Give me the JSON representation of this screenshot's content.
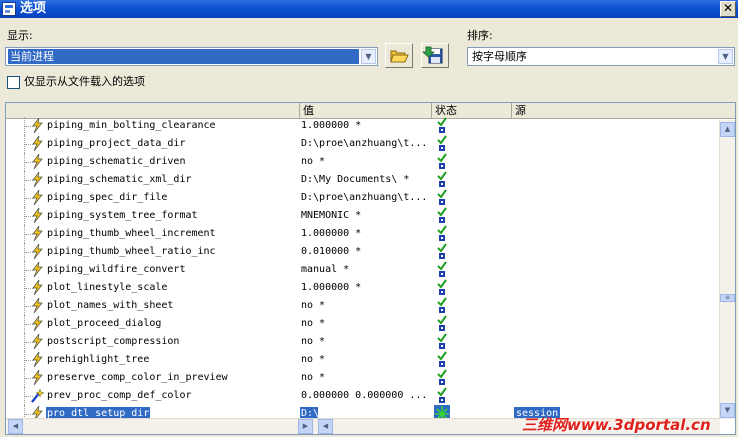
{
  "window": {
    "title": "选项"
  },
  "display": {
    "label": "显示:",
    "selected": "当前进程",
    "only_loaded_label": "仅显示从文件载入的选项"
  },
  "sort": {
    "label": "排序:",
    "selected": "按字母顺序"
  },
  "table": {
    "columns": {
      "name": "",
      "value": "值",
      "status": "状态",
      "source": "源"
    },
    "rows": [
      {
        "name": "piping_min_bolting_clearance",
        "value": "1.000000 *",
        "icon": "lightning-icon"
      },
      {
        "name": "piping_project_data_dir",
        "value": "D:\\proe\\anzhuang\\t...",
        "icon": "lightning-icon"
      },
      {
        "name": "piping_schematic_driven",
        "value": "no *",
        "icon": "lightning-icon"
      },
      {
        "name": "piping_schematic_xml_dir",
        "value": "D:\\My Documents\\ *",
        "icon": "lightning-icon"
      },
      {
        "name": "piping_spec_dir_file",
        "value": "D:\\proe\\anzhuang\\t...",
        "icon": "lightning-icon"
      },
      {
        "name": "piping_system_tree_format",
        "value": "MNEMONIC *",
        "icon": "lightning-icon"
      },
      {
        "name": "piping_thumb_wheel_increment",
        "value": "1.000000 *",
        "icon": "lightning-icon"
      },
      {
        "name": "piping_thumb_wheel_ratio_inc",
        "value": "0.010000 *",
        "icon": "lightning-icon"
      },
      {
        "name": "piping_wildfire_convert",
        "value": "manual *",
        "icon": "lightning-icon"
      },
      {
        "name": "plot_linestyle_scale",
        "value": "1.000000 *",
        "icon": "lightning-icon"
      },
      {
        "name": "plot_names_with_sheet",
        "value": "no *",
        "icon": "lightning-icon"
      },
      {
        "name": "plot_proceed_dialog",
        "value": "no *",
        "icon": "lightning-icon"
      },
      {
        "name": "postscript_compression",
        "value": "no *",
        "icon": "lightning-icon"
      },
      {
        "name": "prehighlight_tree",
        "value": "no *",
        "icon": "lightning-icon"
      },
      {
        "name": "preserve_comp_color_in_preview",
        "value": "no *",
        "icon": "lightning-icon"
      },
      {
        "name": "prev_proc_comp_def_color",
        "value": "0.000000 0.000000 ...",
        "icon": "wand-icon"
      },
      {
        "name": "pro_dtl_setup_dir",
        "value": "D:\\",
        "icon": "lightning-icon",
        "source": "session",
        "selected": true
      }
    ]
  },
  "watermark": "三维网www.3dportal.cn",
  "colors": {
    "selection": "#316ac5",
    "titlebar": "#0a4fd1",
    "check": "#1e9e1e"
  }
}
